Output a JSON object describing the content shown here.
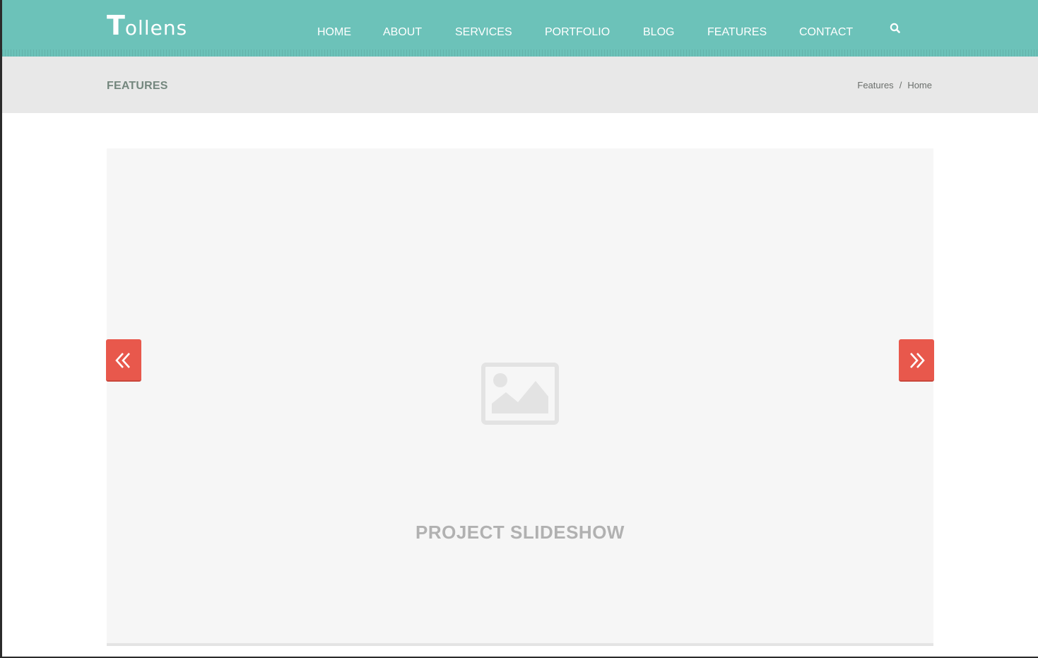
{
  "brand": {
    "logo_initial": "T",
    "logo_rest": "ollens"
  },
  "nav": {
    "items": [
      {
        "label": "HOME"
      },
      {
        "label": "ABOUT"
      },
      {
        "label": "SERVICES"
      },
      {
        "label": "PORTFOLIO"
      },
      {
        "label": "BLOG"
      },
      {
        "label": "FEATURES"
      },
      {
        "label": "CONTACT"
      }
    ],
    "search_icon": "search-icon"
  },
  "page_header": {
    "title": "FEATURES",
    "breadcrumb": {
      "items": [
        "Features",
        "Home"
      ],
      "separator": "/"
    }
  },
  "slideshow": {
    "caption": "PROJECT SLIDESHOW",
    "image_icon": "image-placeholder-icon",
    "prev_icon": "double-chevron-left-icon",
    "next_icon": "double-chevron-right-icon"
  },
  "colors": {
    "header_bg": "#6cc2b9",
    "title_bar_bg": "#e8e8e8",
    "accent": "#e8584c",
    "page_title": "#74877e"
  }
}
